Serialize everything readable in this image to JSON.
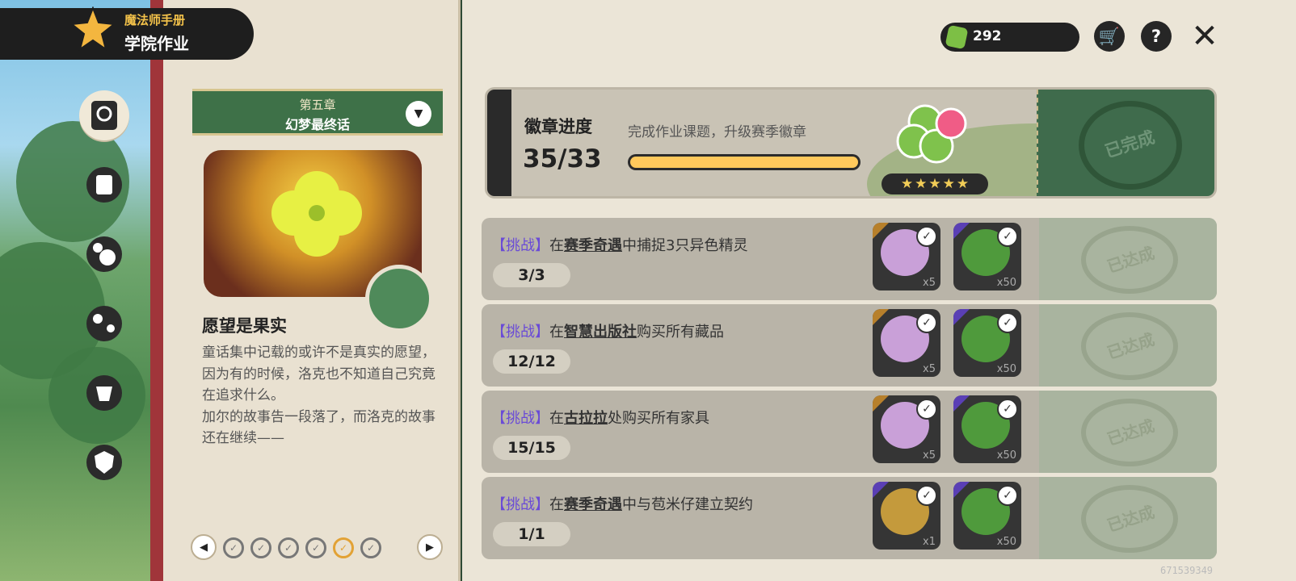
{
  "header": {
    "subtitle": "魔法师手册",
    "title": "学院作业"
  },
  "currency": {
    "icon": "clover-gem-icon",
    "value": "292"
  },
  "top_buttons": [
    "cart-icon",
    "help-icon",
    "close-icon"
  ],
  "side_nav": [
    "homework-book-icon",
    "card-icon",
    "star-bubbles-icon",
    "pet-paw-icon",
    "mask-icon",
    "shield-icon"
  ],
  "chapter": {
    "number": "第五章",
    "name": "幻梦最终话"
  },
  "story": {
    "title": "愿望是果实",
    "text": "童话集中记载的或许不是真实的愿望，因为有的时候，洛克也不知道自己究竟在追求什么。\n加尔的故事告一段落了，而洛克的故事还在继续——"
  },
  "pager": {
    "total": 6,
    "current": 5
  },
  "badge": {
    "label": "徽章进度",
    "desc": "完成作业课题，升级赛季徽章",
    "count": "35/33",
    "progress": 1.0,
    "stars": 5,
    "stamp": "已完成"
  },
  "tasks": [
    {
      "tag": "【挑战】",
      "pre": "在",
      "loc": "赛季奇遇",
      "post": "中捕捉3只异色精灵",
      "progress": "3/3",
      "done": "已达成",
      "rewards": [
        {
          "qty": "x5",
          "color": "#c9a0d8",
          "corner": "gold"
        },
        {
          "qty": "x50",
          "color": "#4f9a3c",
          "corner": "purple"
        }
      ]
    },
    {
      "tag": "【挑战】",
      "pre": "在",
      "loc": "智慧出版社",
      "post": "购买所有藏品",
      "progress": "12/12",
      "done": "已达成",
      "rewards": [
        {
          "qty": "x5",
          "color": "#c9a0d8",
          "corner": "gold"
        },
        {
          "qty": "x50",
          "color": "#4f9a3c",
          "corner": "purple"
        }
      ]
    },
    {
      "tag": "【挑战】",
      "pre": "在",
      "loc": "古拉拉",
      "post": "处购买所有家具",
      "progress": "15/15",
      "done": "已达成",
      "rewards": [
        {
          "qty": "x5",
          "color": "#c9a0d8",
          "corner": "gold"
        },
        {
          "qty": "x50",
          "color": "#4f9a3c",
          "corner": "purple"
        }
      ]
    },
    {
      "tag": "【挑战】",
      "pre": "在",
      "loc": "赛季奇遇",
      "post": "中与苞米仔建立契约",
      "progress": "1/1",
      "done": "已达成",
      "rewards": [
        {
          "qty": "x1",
          "color": "#c49a3c",
          "corner": "purple"
        },
        {
          "qty": "x50",
          "color": "#4f9a3c",
          "corner": "purple"
        }
      ]
    }
  ],
  "uid": "671539349"
}
